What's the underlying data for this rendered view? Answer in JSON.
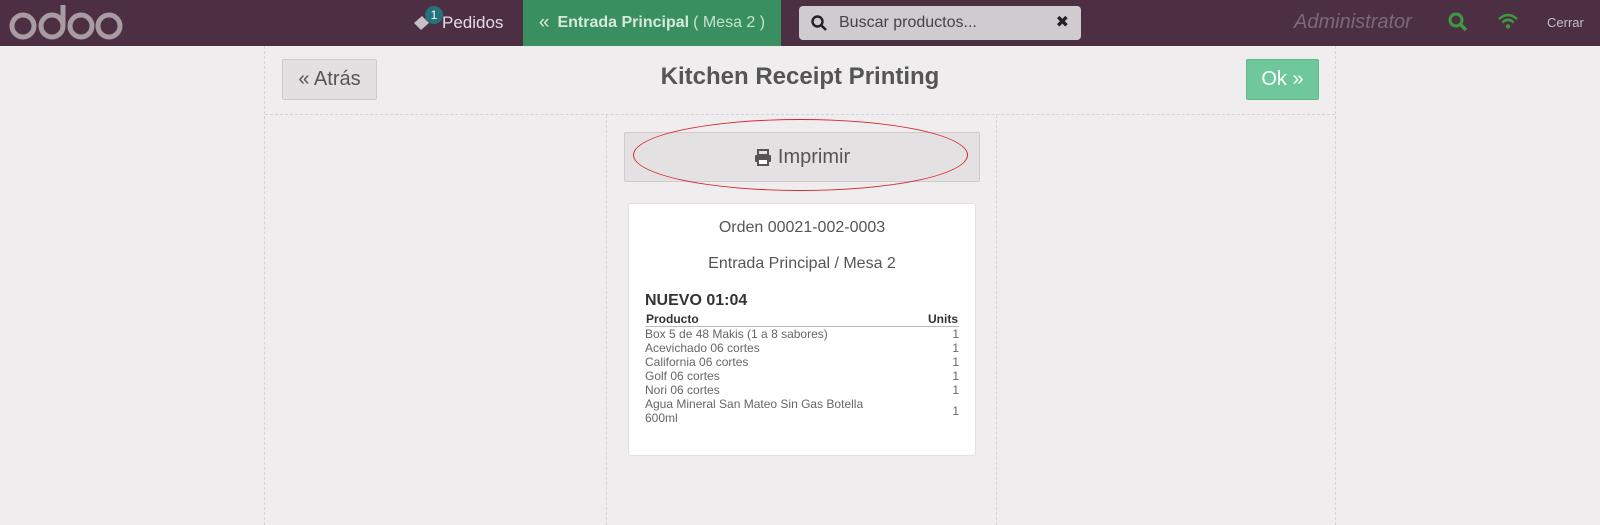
{
  "topbar": {
    "logo_text": "odoo",
    "orders_label": "Pedidos",
    "orders_badge": "1",
    "table_tab_main": "Entrada Principal",
    "table_tab_table": "( Mesa 2 )",
    "search_placeholder": "Buscar productos...",
    "user_name": "Administrator",
    "close_label": "Cerrar"
  },
  "screen": {
    "back_label": "« Atrás",
    "title": "Kitchen Receipt Printing",
    "ok_label": "Ok »",
    "print_label": "Imprimir"
  },
  "receipt": {
    "order": "Orden 00021-002-0003",
    "table": "Entrada Principal / Mesa 2",
    "time_label": "NUEVO 01:04",
    "col_product": "Producto",
    "col_units": "Units",
    "lines": [
      {
        "name": "Box 5 de 48 Makis (1 a 8 sabores)",
        "qty": "1"
      },
      {
        "name": "Acevichado 06 cortes",
        "qty": "1"
      },
      {
        "name": "California 06 cortes",
        "qty": "1"
      },
      {
        "name": "Golf 06 cortes",
        "qty": "1"
      },
      {
        "name": "Nori 06 cortes",
        "qty": "1"
      },
      {
        "name": "Agua Mineral San Mateo Sin Gas Botella 600ml",
        "qty": "1"
      }
    ]
  },
  "colors": {
    "topbar": "#4c2f43",
    "table_tab": "#3a8f61",
    "ok_button": "#6ec89b",
    "annotation": "#d8262c"
  }
}
